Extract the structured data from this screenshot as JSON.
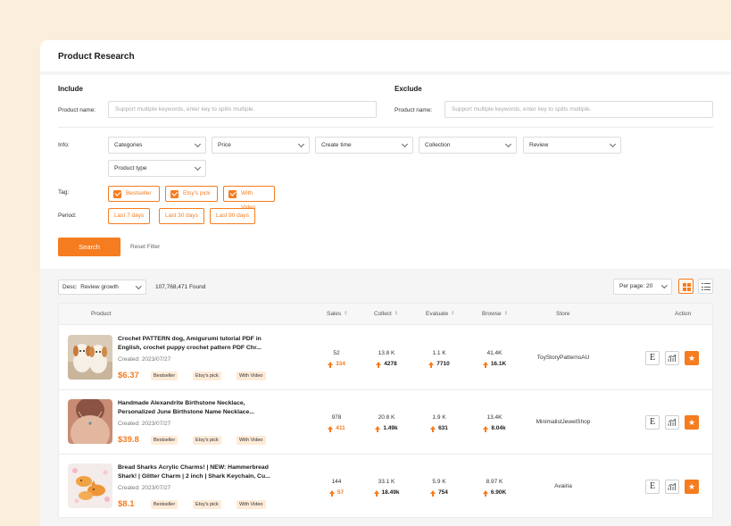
{
  "page_title": "Product Research",
  "include": {
    "heading": "Include",
    "label": "Product name:",
    "placeholder": "Support multiple keywords, enter key to splits multiple."
  },
  "exclude": {
    "heading": "Exclude",
    "label": "Product name:",
    "placeholder": "Support multiple keywords, enter key to splits multiple."
  },
  "info": {
    "label": "Info:",
    "selects": [
      "Categories",
      "Price",
      "Create time",
      "Collection",
      "Review",
      "Product type"
    ]
  },
  "tag": {
    "label": "Tag:",
    "items": [
      "Bestseller",
      "Etsy's pick",
      "With Video"
    ]
  },
  "period": {
    "label": "Period:",
    "items": [
      "Last 7 days",
      "Last 30 days",
      "Last 90 days"
    ]
  },
  "search_label": "Search",
  "reset_label": "Reset Filter",
  "results": {
    "sort_prefix": "Desc:",
    "sort_value": "Review growth",
    "found": "107,768,471 Found",
    "per_page": "Per page: 20"
  },
  "table": {
    "headers": {
      "product": "Product",
      "sales": "Sales",
      "collect": "Collect",
      "evaluate": "Evaluate",
      "browse": "Browse",
      "store": "Store",
      "action": "Action"
    },
    "sort_glyph": "⇕",
    "rows": [
      {
        "name": "Crochet PATTERN dog, Amigurumi tutorial PDF in English, crochet puppy crochet pattern PDF Chr...",
        "created": "Created: 2023/07/27",
        "price": "$6.37",
        "badges": [
          "Bestseller",
          "Etsy's pick",
          "With Video"
        ],
        "sales": "52",
        "sales_growth": "334",
        "collect": "13.8 K",
        "collect_growth": "4278",
        "evaluate": "1.1 K",
        "evaluate_growth": "7710",
        "browse": "41.4K",
        "browse_growth": "16.1K",
        "store": "ToyStoryPatternsAU"
      },
      {
        "name": "Handmade Alexandrite Birthstone Necklace, Personalized June Birthstone Name Necklace...",
        "created": "Created: 2023/07/27",
        "price": "$39.8",
        "badges": [
          "Bestseller",
          "Etsy's pick",
          "With Video"
        ],
        "sales": "978",
        "sales_growth": "411",
        "collect": "20.8 K",
        "collect_growth": "1.49k",
        "evaluate": "1.9 K",
        "evaluate_growth": "631",
        "browse": "13.4K",
        "browse_growth": "8.04k",
        "store": "MinimalistJewelShop"
      },
      {
        "name": "Bread Sharks Acrylic Charms! | NEW: Hammerbread Shark! | Glitter Charm | 2 inch | Shark Keychain, Cu...",
        "created": "Created: 2023/07/27",
        "price": "$8.1",
        "badges": [
          "Bestseller",
          "Etsy's pick",
          "With Video"
        ],
        "sales": "144",
        "sales_growth": "57",
        "collect": "33.1 K",
        "collect_growth": "18.49k",
        "evaluate": "5.9 K",
        "evaluate_growth": "754",
        "browse": "8.97 K",
        "browse_growth": "6.90K",
        "store": "Avairia"
      }
    ]
  },
  "action_icons": [
    "etsy-icon",
    "chart-icon",
    "star-icon"
  ],
  "action_glyphs": {
    "etsy": "E",
    "star": "★"
  },
  "colors": {
    "accent": "#f57c1f",
    "badge_bg": "#fdebd8",
    "page_bg": "#fbeedd"
  }
}
